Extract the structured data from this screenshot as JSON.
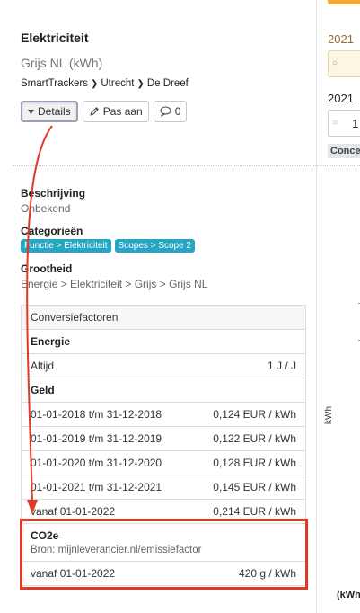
{
  "header": {
    "title": "Elektriciteit",
    "subtitle": "Grijs NL (kWh)",
    "breadcrumb": [
      "SmartTrackers",
      "Utrecht",
      "De Dreef"
    ]
  },
  "buttons": {
    "details_label": "Details",
    "edit_label": "Pas aan",
    "comments_count": "0"
  },
  "info": {
    "description_label": "Beschrijving",
    "description_value": "Onbekend",
    "categories_label": "Categorieën",
    "categories": [
      "Functie > Elektriciteit",
      "Scopes > Scope 2"
    ],
    "quantity_label": "Grootheid",
    "quantity_value": "Energie > Elektriciteit > Grijs > Grijs NL"
  },
  "conversion": {
    "header": "Conversiefactoren",
    "energy_label": "Energie",
    "energy_rows": [
      {
        "period": "Altijd",
        "value": "1 J / J"
      }
    ],
    "money_label": "Geld",
    "money_rows": [
      {
        "period": "01-01-2018 t/m 31-12-2018",
        "value": "0,124 EUR / kWh"
      },
      {
        "period": "01-01-2019 t/m 31-12-2019",
        "value": "0,122 EUR / kWh"
      },
      {
        "period": "01-01-2020 t/m 31-12-2020",
        "value": "0,128 EUR / kWh"
      },
      {
        "period": "01-01-2021 t/m 31-12-2021",
        "value": "0,145 EUR / kWh"
      },
      {
        "period": "vanaf 01-01-2022",
        "value": "0,214 EUR / kWh"
      }
    ],
    "co2_label": "CO2e",
    "co2_source": "Bron: mijnleverancier.nl/emissiefactor",
    "co2_rows": [
      {
        "period": "vanaf 01-01-2022",
        "value": "420 g / kWh"
      }
    ]
  },
  "right_panel": {
    "year_1": "2021",
    "year_2": "2021",
    "input_value": "1",
    "badge": "Conce",
    "y_axis_label": "kWh",
    "x_unit": "(kWh"
  },
  "colors": {
    "tag": "#27a5c4",
    "highlight": "#e03a26",
    "accent": "#f4a836"
  }
}
